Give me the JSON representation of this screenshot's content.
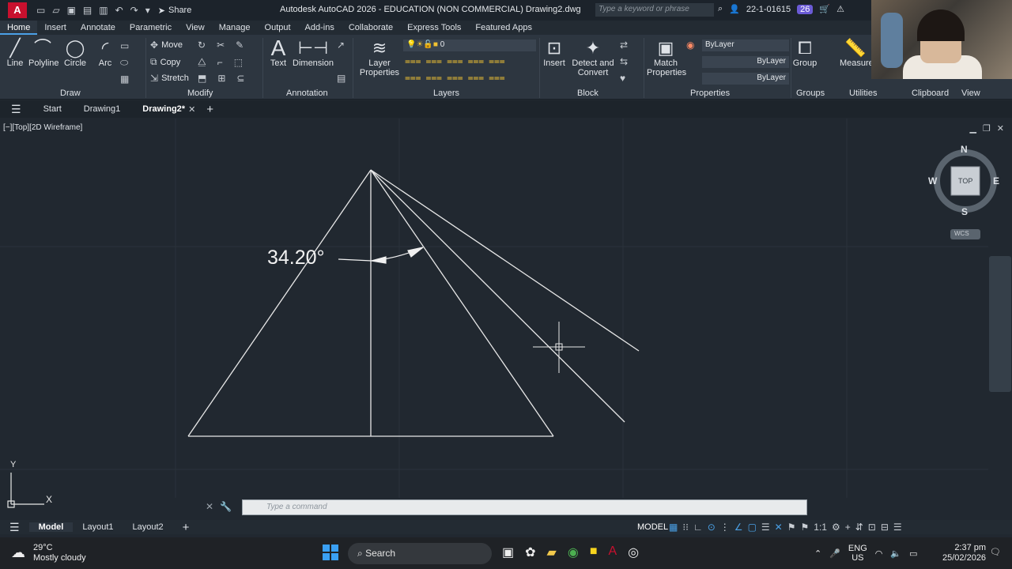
{
  "titlebar": {
    "app_icon": "A",
    "share_label": "Share",
    "title": "Autodesk AutoCAD 2026 - EDUCATION (NON COMMERCIAL)    Drawing2.dwg",
    "search_placeholder": "Type a keyword or phrase",
    "user": "22-1-01615",
    "badge": "26"
  },
  "ribbon_tabs": [
    "Home",
    "Insert",
    "Annotate",
    "Parametric",
    "View",
    "Manage",
    "Output",
    "Add-ins",
    "Collaborate",
    "Express Tools",
    "Featured Apps"
  ],
  "ribbon": {
    "draw": {
      "line": "Line",
      "polyline": "Polyline",
      "circle": "Circle",
      "arc": "Arc",
      "title": "Draw"
    },
    "modify": {
      "move": "Move",
      "copy": "Copy",
      "stretch": "Stretch",
      "title": "Modify"
    },
    "annotation": {
      "text": "Text",
      "dimension": "Dimension",
      "title": "Annotation"
    },
    "layers": {
      "layer_properties": "Layer Properties",
      "current_layer": "0",
      "title": "Layers"
    },
    "block": {
      "insert": "Insert",
      "detect": "Detect and Convert",
      "title": "Block"
    },
    "properties": {
      "match": "Match Properties",
      "color": "ByLayer",
      "linetype": "ByLayer",
      "lineweight": "ByLayer",
      "title": "Properties"
    },
    "groups": {
      "group": "Group",
      "title": "Groups"
    },
    "utilities": {
      "measure": "Measure",
      "title": "Utilities"
    },
    "clipboard": {
      "title": "Clipboard"
    },
    "view": {
      "title": "View"
    }
  },
  "file_tabs": {
    "start": "Start",
    "drawing1": "Drawing1",
    "drawing2": "Drawing2*"
  },
  "viewport": {
    "label": "[−][Top][2D Wireframe]",
    "angle_text": "34.20°",
    "viewcube": {
      "n": "N",
      "s": "S",
      "e": "E",
      "w": "W",
      "top": "TOP",
      "wcs": "WCS"
    },
    "ucs": {
      "x": "X",
      "y": "Y"
    },
    "command_placeholder": "Type a command"
  },
  "layout_tabs": [
    "Model",
    "Layout1",
    "Layout2"
  ],
  "status": {
    "model": "MODEL"
  },
  "taskbar": {
    "temp": "29°C",
    "weather": "Mostly cloudy",
    "search": "Search",
    "lang_top": "ENG",
    "lang_bottom": "US",
    "time": "2:37 pm",
    "date": "25/02/2026"
  },
  "colors": {
    "accent": "#4aa0e6",
    "autocad_red": "#c8102e",
    "canvas": "#212830"
  }
}
